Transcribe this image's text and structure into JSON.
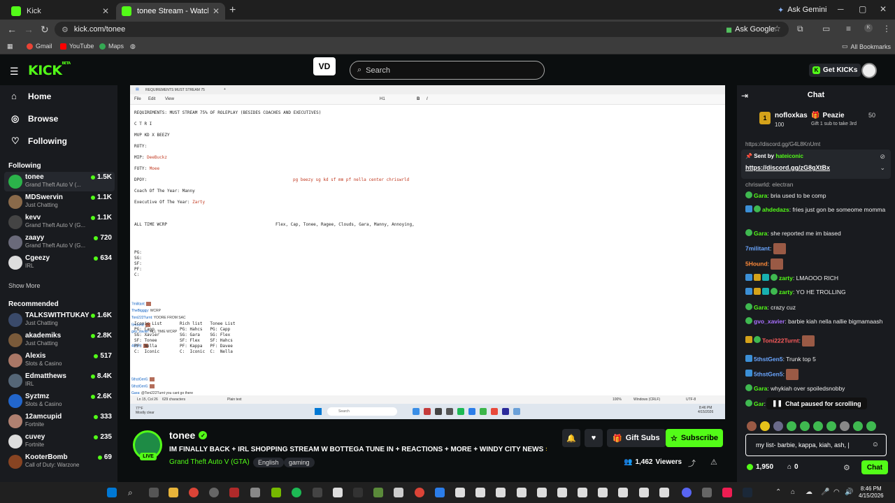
{
  "browser": {
    "tabs": [
      {
        "title": "Kick",
        "active": false
      },
      {
        "title": "tonee Stream - Watch Live o",
        "active": true
      }
    ],
    "ask_gemini": "Ask Gemini",
    "url": "kick.com/tonee",
    "ask_google": "Ask Google",
    "bookmarks": [
      "Gmail",
      "YouTube",
      "Maps"
    ],
    "all_bookmarks": "All Bookmarks"
  },
  "kick": {
    "logo": "KICK",
    "logo_beta": "BETA",
    "vd_badge": "VD",
    "search_placeholder": "Search",
    "get_kicks": "Get KICKs"
  },
  "sidebar": {
    "nav": [
      {
        "label": "Home",
        "icon": "home-icon"
      },
      {
        "label": "Browse",
        "icon": "compass-icon"
      },
      {
        "label": "Following",
        "icon": "heart-icon"
      }
    ],
    "following_header": "Following",
    "following": [
      {
        "name": "tonee",
        "category": "Grand Theft Auto V (...",
        "viewers": "1.5K",
        "color": "#2bb34a"
      },
      {
        "name": "MDSwervin",
        "category": "Just Chatting",
        "viewers": "1.1K",
        "color": "#8a6a4a"
      },
      {
        "name": "kevv",
        "category": "Grand Theft Auto V (G...",
        "viewers": "1.1K",
        "color": "#444"
      },
      {
        "name": "zaayy",
        "category": "Grand Theft Auto V (G...",
        "viewers": "720",
        "color": "#6a6a7a"
      },
      {
        "name": "Cgeezy",
        "category": "IRL",
        "viewers": "634",
        "color": "#ddd"
      }
    ],
    "show_more": "Show More",
    "recommended_header": "Recommended",
    "recommended": [
      {
        "name": "TALKSWITHTUKAY",
        "category": "Just Chatting",
        "viewers": "1.6K",
        "color": "#3a4a6a"
      },
      {
        "name": "akademiks",
        "category": "Just Chatting",
        "viewers": "2.8K",
        "color": "#7a5a3a"
      },
      {
        "name": "Alexis",
        "category": "Slots & Casino",
        "viewers": "517",
        "color": "#aa7766"
      },
      {
        "name": "Edmatthews",
        "category": "IRL",
        "viewers": "8.4K",
        "color": "#556677"
      },
      {
        "name": "Syztmz",
        "category": "Slots & Casino",
        "viewers": "2.6K",
        "color": "#2266cc"
      },
      {
        "name": "12amcupid",
        "category": "Fortnite",
        "viewers": "333",
        "color": "#b08070"
      },
      {
        "name": "cuvey",
        "category": "Fortnite",
        "viewers": "235",
        "color": "#ddd"
      },
      {
        "name": "KooterBomb",
        "category": "Call of Duty: Warzone",
        "viewers": "69",
        "color": "#884422"
      }
    ]
  },
  "stream_screen": {
    "doc_tab": "REQUIREMENTS MUST STREAM 75",
    "menu": [
      "File",
      "Edit",
      "View"
    ],
    "heading_label": "H1",
    "lines": [
      {
        "text": "REQUIREMENTS: MUST STREAM 75% OF ROLEPLAY (BESIDES COACHES AND EXECUTIVES)",
        "red": ""
      },
      {
        "text": "C T R I",
        "red": ""
      },
      {
        "text": "MVP KD X BEEZY",
        "red": ""
      },
      {
        "text": "ROTY:",
        "red": ""
      },
      {
        "text": "MIP: ",
        "red": "DeeBuckz"
      },
      {
        "text": "FOTY: ",
        "red": "Moee"
      },
      {
        "text": "DPOY:",
        "red": ""
      },
      {
        "text": "Coach Of The Year: Manny",
        "red": ""
      },
      {
        "text": "Executive Of The Year: ",
        "red": "Zarty"
      },
      {
        "text": "ALL TIME WCRP",
        "red": ""
      },
      {
        "text": "PG:",
        "red": ""
      },
      {
        "text": "SG:",
        "red": ""
      },
      {
        "text": "SF:",
        "red": ""
      },
      {
        "text": "PF:",
        "red": ""
      },
      {
        "text": "C:",
        "red": ""
      }
    ],
    "dpoy_mid": "pg beezy sg kd sf mm pf nella center chriswrld",
    "wcrp_mid": "Flex, Cap, Tonee, Ragee, Clouds, Gara, Manny, Annoying,",
    "lists_text": "Iconic List       Rich list   Tonee List\nPG: Capp          PG: Hahcs   PG: Capp\nSG: Xavier        SG: Gara    SG: Flex\nSF: Tonee         SF: Flex    SF: Hahcs\nPF: Nella         PF: Kappa   PF: Davee\nC:  Iconic        C:  Iconic  C:  Nella",
    "overlay_chat": [
      {
        "user": "7militant:",
        "text": ""
      },
      {
        "user": "TheBigggy:",
        "text": "WCRP"
      },
      {
        "user": "Toni222Turnt:",
        "text": "YOORE FROM SAC"
      },
      {
        "user": "5Hound:",
        "text": ""
      },
      {
        "user": "gvo_xavier:",
        "text": "ALL TIME WCRP"
      },
      {
        "user": "48209:",
        "text": ""
      },
      {
        "user": "5thstGen5:",
        "text": ""
      },
      {
        "user": "5thstGen5:",
        "text": ""
      },
      {
        "user": "Gara:",
        "text": "@Toni222Turnt you cant go there"
      }
    ],
    "status_left": "Ln 15, Col 26",
    "status_chars": "629 characters",
    "status_mode": "Plain text",
    "status_zoom": "100%",
    "status_eol": "Windows (CRLF)",
    "status_enc": "UTF-8",
    "weather_temp": "77°F",
    "weather_desc": "Mostly clear",
    "taskbar_search": "Search",
    "clock_time": "8:46 PM",
    "clock_date": "4/15/2026"
  },
  "stream": {
    "live": "LIVE",
    "name": "tonee",
    "title": "IM FINALLY BACK + IRL SHOPPING STREAM W BOTTEGA TUNE IN + REACTIONS + MORE + WINDY CITY NEWS 🌟🙏🏾",
    "category": "Grand Theft Auto V (GTA)",
    "tags": [
      "English",
      "gaming"
    ],
    "gift_subs": "Gift Subs",
    "subscribe": "Subscribe",
    "viewers_count": "1,462",
    "viewers_label": "Viewers"
  },
  "chat": {
    "title": "Chat",
    "leaderboard": {
      "rank": "1",
      "name": "nofloxkas",
      "count": "100",
      "second_name": "Peazie",
      "second_count": "50",
      "second_hint": "Gift 1 sub to take 3rd"
    },
    "partial_link": "https://discord.gg/G4L8KnUmt",
    "pinned": {
      "sent_by": "Sent by",
      "sender": "hateiconic",
      "link": "https://discord.gg/zG8gXtBx"
    },
    "partial_top": "chriswrld: electran",
    "messages": [
      {
        "user": "Gara",
        "color": "#53fc18",
        "text": "bria used to be comp",
        "badges": [
          "g"
        ]
      },
      {
        "user": "ahdedazs",
        "color": "#53fc18",
        "text": "fries just gon be someome momma",
        "badges": [
          "b",
          "g"
        ]
      },
      {
        "user": "Gara",
        "color": "#53fc18",
        "text": "she reported me im biased",
        "badges": [
          "g"
        ]
      },
      {
        "user": "7militant",
        "color": "#6aa6ff",
        "text": "",
        "badges": [],
        "emote": true
      },
      {
        "user": "5Hound",
        "color": "#ff8a3a",
        "text": "",
        "badges": [],
        "emote": true
      },
      {
        "user": "zarty",
        "color": "#53fc18",
        "text": "LMAOOO RICH",
        "badges": [
          "b",
          "y",
          "t",
          "g"
        ]
      },
      {
        "user": "zarty",
        "color": "#53fc18",
        "text": "YO HE TROLLING",
        "badges": [
          "b",
          "y",
          "t",
          "g"
        ]
      },
      {
        "user": "Gara",
        "color": "#53fc18",
        "text": "crazy cuz",
        "badges": [
          "g"
        ]
      },
      {
        "user": "gvo_xavier",
        "color": "#a970ff",
        "text": "barbie kiah nella nallie bigmamaash",
        "badges": [
          "g"
        ]
      },
      {
        "user": "Toni222Turnt",
        "color": "#ff5c5c",
        "text": "",
        "badges": [
          "y",
          "g"
        ],
        "emote": true
      },
      {
        "user": "5thstGen5",
        "color": "#6aa6ff",
        "text": "Trunk top 5",
        "badges": [
          "b"
        ]
      },
      {
        "user": "5thstGen5",
        "color": "#6aa6ff",
        "text": "",
        "badges": [
          "b"
        ],
        "emote": true
      },
      {
        "user": "Gara",
        "color": "#53fc18",
        "text": "whykiah over spoiledsnobby",
        "badges": [
          "g"
        ]
      },
      {
        "user": "Gar",
        "color": "#53fc18",
        "text": "",
        "badges": [
          "g"
        ]
      }
    ],
    "paused": "Chat paused for scrolling",
    "input_value": "my list- barbie, kappa, kiah, ash, |",
    "points": "1,950",
    "zero": "0",
    "send": "Chat"
  },
  "colors": {
    "brand": "#53fc18",
    "bg": "#0b0e0f",
    "panel": "#191b1f"
  }
}
